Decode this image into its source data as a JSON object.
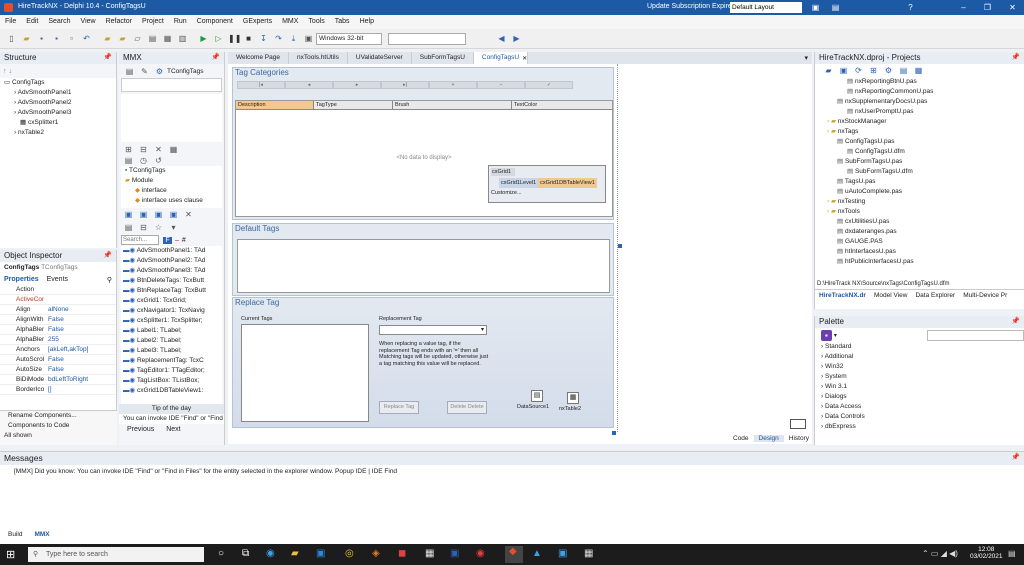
{
  "window": {
    "title": "HireTrackNX - Delphi 10.4 - ConfigTagsU",
    "update_label": "Update Subscription Expired",
    "layout": "Default Layout"
  },
  "menu": [
    "File",
    "Edit",
    "Search",
    "View",
    "Refactor",
    "Project",
    "Run",
    "Component",
    "GExperts",
    "MMX",
    "Tools",
    "Tabs",
    "Help"
  ],
  "toolbar": {
    "platform": "Windows 32-bit",
    "config": ""
  },
  "structure": {
    "title": "Structure",
    "items": [
      "ConfigTags",
      "AdvSmoothPanel1",
      "AdvSmoothPanel2",
      "AdvSmoothPanel3",
      "cxSplitter1",
      "nxTable2"
    ]
  },
  "mmx": {
    "title": "MMX",
    "class_label": "TConfigTags",
    "tree": [
      "TConfigTags",
      "Module",
      "interface",
      "interface uses clause"
    ],
    "search_placeholder": "Search...",
    "filter_letters": [
      "F",
      "#"
    ],
    "entries": [
      "AdvSmoothPanel1: TAd",
      "AdvSmoothPanel2: TAd",
      "AdvSmoothPanel3: TAd",
      "BtnDeleteTags: TcxButt",
      "BtnReplaceTag: TcxButt",
      "cxGrid1: TcxGrid;",
      "cxNavigator1: TcxNavig",
      "cxSplitter1: TcxSplitter;",
      "Label1: TLabel;",
      "Label2: TLabel;",
      "Label3: TLabel;",
      "ReplacementTag: TcxC",
      "TagEditor1: TTagEditor;",
      "TagListBox: TListBox;",
      "cxGrid1DBTableView1:"
    ],
    "tip_title": "Tip of the day",
    "tip_text": "You can invoke IDE \"Find\" or \"Find",
    "prev": "Previous",
    "next": "Next"
  },
  "object_inspector": {
    "title": "Object Inspector",
    "object": "ConfigTags",
    "object_class": "TConfigTags",
    "tabs": [
      "Properties",
      "Events"
    ],
    "props": [
      [
        "Action",
        ""
      ],
      [
        "ActiveCon",
        ""
      ],
      [
        "Align",
        "alNone"
      ],
      [
        "AlignWithI",
        "False"
      ],
      [
        "AlphaBlen",
        "False"
      ],
      [
        "AlphaBlen",
        "255"
      ],
      [
        "Anchors",
        "[akLeft,akTop]"
      ],
      [
        "AutoScroll",
        "False"
      ],
      [
        "AutoSize",
        "False"
      ],
      [
        "BiDiMode",
        "bdLeftToRight"
      ],
      [
        "BorderIcor",
        "[]"
      ]
    ],
    "footer_items": [
      "Rename Components...",
      "Components to Code"
    ],
    "footer_status": "All shown"
  },
  "editor": {
    "tabs": [
      "Welcome Page",
      "nxTools.htUtils",
      "UValidateServer",
      "SubFormTagsU",
      "ConfigTagsU"
    ],
    "bottom_tabs": [
      "Code",
      "Design",
      "History"
    ]
  },
  "form": {
    "tag_categories": "Tag Categories",
    "columns": [
      "Description",
      "TagType",
      "Brush",
      "TextColor"
    ],
    "no_data": "<No data to display>",
    "cxgrid_root": "cxGrid1",
    "cxgrid_level": "cxGrid1Level1",
    "cxgrid_view": "cxGrid1DBTableView1",
    "customize": "Customize...",
    "default_tags": "Default Tags",
    "replace_tag": "Replace Tag",
    "current_tags": "Current Tags",
    "replacement_tag": "Replacement Tag",
    "help_text": "When replacing a value tag, if the replacement Tag ends with an '=' then all Matching tags will be updated, otherwise just a tag matching this value will be replaced.",
    "btn_replace": "Replace Tag",
    "btn_delete": "Delete Delete",
    "ds_label": "DataSource1",
    "tbl_label": "nxTable2"
  },
  "projects": {
    "title": "HireTrackNX.dproj - Projects",
    "items": [
      [
        "nxReportingBtnU.pas",
        2
      ],
      [
        "nxReportingCommonU.pas",
        2
      ],
      [
        "nxSupplementaryDocsU.pas",
        1
      ],
      [
        "nxUserPromptU.pas",
        2
      ],
      [
        "nxStockManager",
        0
      ],
      [
        "nxTags",
        0
      ],
      [
        "ConfigTagsU.pas",
        1
      ],
      [
        "ConfigTagsU.dfm",
        2
      ],
      [
        "SubFormTagsU.pas",
        1
      ],
      [
        "SubFormTagsU.dfm",
        2
      ],
      [
        "TagsU.pas",
        1
      ],
      [
        "uAutoComplete.pas",
        1
      ],
      [
        "nxTesting",
        0
      ],
      [
        "nxTools",
        0
      ],
      [
        "cxUtilitiesU.pas",
        1
      ],
      [
        "dxdateranges.pas",
        1
      ],
      [
        "GAUGE.PAS",
        1
      ],
      [
        "htInterfacesU.pas",
        1
      ],
      [
        "htPublicInterfacesU.pas",
        1
      ]
    ],
    "path": "D:\\HireTrack NX\\Source\\nxTags\\ConfigTagsU.dfm",
    "tabs": [
      "HireTrackNX.dr",
      "Model View",
      "Data Explorer",
      "Multi-Device Pr"
    ]
  },
  "palette": {
    "title": "Palette",
    "items": [
      "Standard",
      "Additional",
      "Win32",
      "System",
      "Win 3.1",
      "Dialogs",
      "Data Access",
      "Data Controls",
      "dbExpress"
    ]
  },
  "messages": {
    "title": "Messages",
    "text": "[MMX] Did you know: You can invoke IDE \"Find\" or \"Find in Files\" for the entity selected in the explorer window. Popup IDE | IDE Find",
    "tabs": [
      "Build",
      "MMX"
    ]
  },
  "taskbar": {
    "search": "Type here to search",
    "time": "12:08",
    "date": "03/02/2021"
  }
}
